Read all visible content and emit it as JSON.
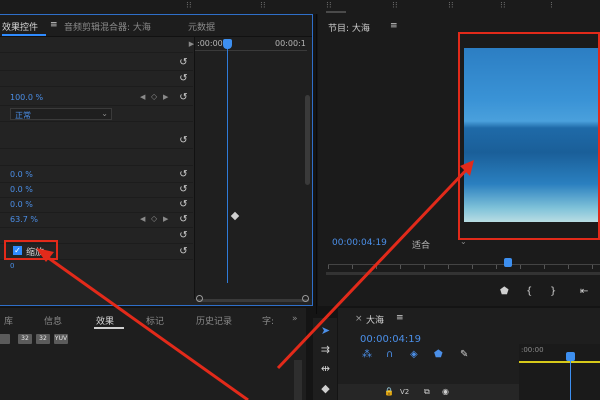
{
  "top_workspaces": [
    "",
    "",
    "",
    "",
    "",
    "",
    ""
  ],
  "effect_controls": {
    "tab_label": "效果控件",
    "tab_menu": "≡",
    "tab_audio_mixer": "音频剪辑混合器: 大海",
    "tab_metadata": "元数据",
    "timecode_start": ":00:00",
    "timecode_end": "00:00:1",
    "opacity_value": "100.0 %",
    "blend_mode": "正常",
    "pos_x_value": "0.0 %",
    "pos_y_value": "0.0 %",
    "anchor_value": "0.0 %",
    "scale_value": "63.7 %",
    "uniform_scale_label": "缩放",
    "zero_value": "0"
  },
  "program_monitor": {
    "title": "节目: 大海",
    "menu": "≡",
    "timecode": "00:00:04:19",
    "fit_label": "适合"
  },
  "effects_panel": {
    "tabs": [
      "库",
      "信息",
      "效果",
      "标记",
      "历史记录",
      "字:"
    ],
    "more": "»",
    "icons": [
      "",
      "32",
      "32",
      "YUV"
    ]
  },
  "timeline": {
    "close": "×",
    "sequence_name": "大海",
    "menu": "≡",
    "timecode": "00:00:04:19",
    "ruler_tc": ":00:00",
    "track_name": "V2"
  },
  "colors": {
    "accent_blue": "#2f8bff",
    "annotation_red": "#e22a1a",
    "inout_yellow": "#d7c91a"
  }
}
